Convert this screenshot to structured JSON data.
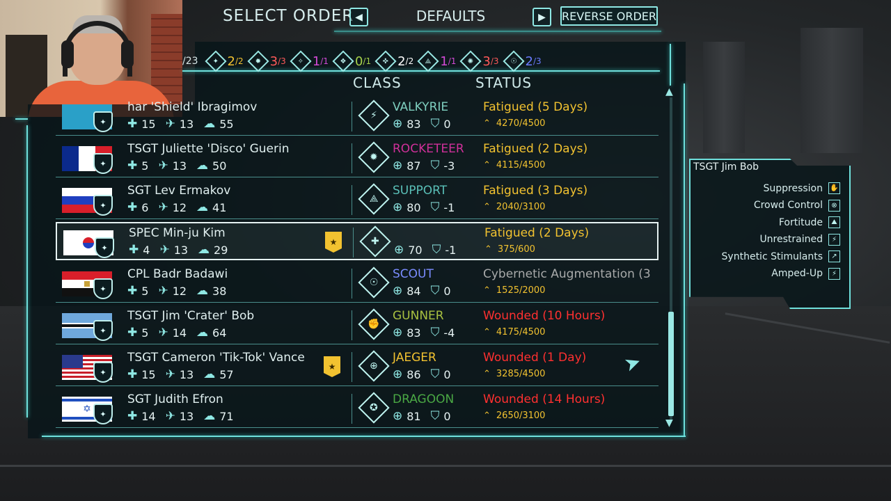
{
  "header": {
    "title": "SELECT ORDER",
    "prev_icon": "◀",
    "next_icon": "▶",
    "sort_mode": "DEFAULTS",
    "reverse_label": "REVERSE ORDER"
  },
  "class_counts": {
    "partial_total": "/23",
    "items": [
      {
        "icon": "valkyrie-icon",
        "num": "2",
        "den": "/2",
        "color": "#f2c230"
      },
      {
        "icon": "rocketeer-icon",
        "num": "3",
        "den": "/3",
        "color": "#ff5a5a"
      },
      {
        "icon": "support-icon",
        "num": "1",
        "den": "/1",
        "color": "#d24ad6"
      },
      {
        "icon": "gunner-icon",
        "num": "0",
        "den": "/1",
        "color": "#a6d24a"
      },
      {
        "icon": "scout-icon",
        "num": "2",
        "den": "/2",
        "color": "#ffffff"
      },
      {
        "icon": "jaeger-icon",
        "num": "1",
        "den": "/1",
        "color": "#d24ad6"
      },
      {
        "icon": "dragoon-icon",
        "num": "3",
        "den": "/3",
        "color": "#ff5a5a"
      },
      {
        "icon": "sectoid-icon",
        "num": "2",
        "den": "/3",
        "color": "#6a7cff"
      }
    ]
  },
  "columns": {
    "class": "CLASS",
    "status": "STATUS"
  },
  "soldiers": [
    {
      "name": "har 'Shield' Ibragimov",
      "hp": "15",
      "mob": "13",
      "will": "55",
      "class": "VALKYRIE",
      "class_color": "#7fd0c0",
      "aim": "83",
      "def": "0",
      "status": "Fatigued (5 Days)",
      "status_color": "#f2c230",
      "xp": "4270/4500",
      "flag": "kazakhstan",
      "promo": false
    },
    {
      "name": "TSGT Juliette 'Disco' Guerin",
      "hp": "5",
      "mob": "13",
      "will": "50",
      "class": "ROCKETEER",
      "class_color": "#d0309a",
      "aim": "87",
      "def": "-3",
      "status": "Fatigued (2 Days)",
      "status_color": "#f2c230",
      "xp": "4115/4500",
      "flag": "france",
      "promo": false
    },
    {
      "name": "SGT Lev Ermakov",
      "hp": "6",
      "mob": "12",
      "will": "41",
      "class": "SUPPORT",
      "class_color": "#5ac0b8",
      "aim": "80",
      "def": "-1",
      "status": "Fatigued (3 Days)",
      "status_color": "#f2c230",
      "xp": "2040/3100",
      "flag": "russia",
      "promo": false
    },
    {
      "name": "SPEC Min-ju Kim",
      "hp": "4",
      "mob": "13",
      "will": "29",
      "class": "",
      "class_color": "#5ac0b8",
      "aim": "70",
      "def": "-1",
      "status": "Fatigued (2 Days)",
      "status_color": "#f2c230",
      "xp": "375/600",
      "flag": "korea",
      "promo": true
    },
    {
      "name": "CPL Badr Badawi",
      "hp": "5",
      "mob": "12",
      "will": "38",
      "class": "SCOUT",
      "class_color": "#7a8cff",
      "aim": "84",
      "def": "0",
      "status": "Cybernetic Augmentation (3",
      "status_color": "#a8aaaa",
      "xp": "1525/2000",
      "flag": "egypt",
      "promo": false
    },
    {
      "name": "TSGT Jim 'Crater' Bob",
      "hp": "5",
      "mob": "14",
      "will": "64",
      "class": "GUNNER",
      "class_color": "#a8c040",
      "aim": "83",
      "def": "-4",
      "status": "Wounded (10 Hours)",
      "status_color": "#ff3030",
      "xp": "4175/4500",
      "flag": "botswana",
      "promo": false
    },
    {
      "name": "TSGT Cameron 'Tik-Tok' Vance",
      "hp": "15",
      "mob": "13",
      "will": "57",
      "class": "JAEGER",
      "class_color": "#f2c230",
      "aim": "86",
      "def": "0",
      "status": "Wounded (1 Day)",
      "status_color": "#ff3030",
      "xp": "3285/4500",
      "flag": "usa",
      "promo": true
    },
    {
      "name": "SGT Judith Efron",
      "hp": "14",
      "mob": "13",
      "will": "71",
      "class": "DRAGOON",
      "class_color": "#4aa844",
      "aim": "81",
      "def": "0",
      "status": "Wounded (14 Hours)",
      "status_color": "#ff3030",
      "xp": "2650/3100",
      "flag": "israel",
      "promo": false
    }
  ],
  "side_panel": {
    "title": "TSGT Jim Bob",
    "abilities": [
      "Suppression",
      "Crowd Control",
      "Fortitude",
      "Unrestrained",
      "Synthetic Stimulants",
      "Amped-Up"
    ]
  }
}
